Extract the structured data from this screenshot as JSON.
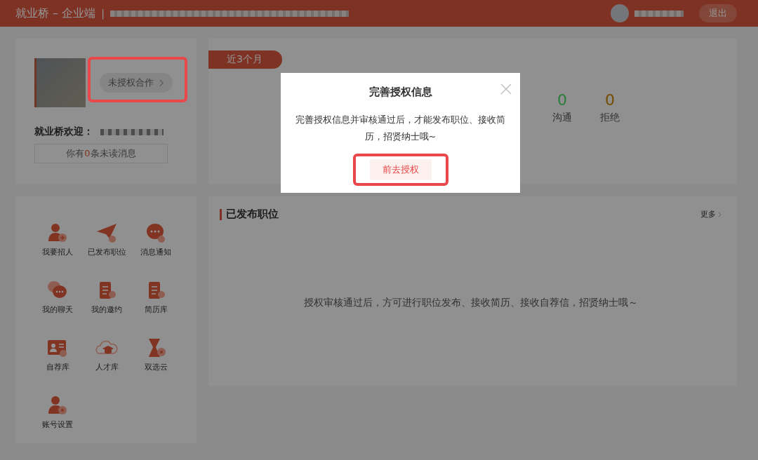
{
  "header": {
    "title": "就业桥 – 企业端",
    "separator": "|",
    "logout": "退出"
  },
  "profile": {
    "status_button": "未授权合作",
    "welcome": "就业桥欢迎：",
    "unread_prefix": "你有",
    "unread_count": "0",
    "unread_suffix": "条未读消息"
  },
  "stats": {
    "period_tab": "近3个月",
    "items": [
      {
        "value": "0",
        "label": "沟通",
        "color": "#2e7d3c"
      },
      {
        "value": "0",
        "label": "拒绝",
        "color": "#744c00"
      }
    ]
  },
  "menu": [
    {
      "kind": "recruit",
      "label": "我要招人"
    },
    {
      "kind": "posted",
      "label": "已发布职位"
    },
    {
      "kind": "notice",
      "label": "消息通知"
    },
    {
      "kind": "chat",
      "label": "我的聊天"
    },
    {
      "kind": "invite",
      "label": "我的邀约"
    },
    {
      "kind": "resume",
      "label": "简历库"
    },
    {
      "kind": "selfrec",
      "label": "自荐库"
    },
    {
      "kind": "talent",
      "label": "人才库"
    },
    {
      "kind": "fair",
      "label": "双选云"
    },
    {
      "kind": "account",
      "label": "账号设置"
    }
  ],
  "jobs_panel": {
    "title": "已发布职位",
    "more": "更多",
    "empty_text": "授权审核通过后，方可进行职位发布、接收简历、接收自荐信，招贤纳士哦～"
  },
  "modal": {
    "title": "完善授权信息",
    "body": "完善授权信息并审核通过后，才能发布职位、接收简历，招贤纳士哦~",
    "button": "前去授权"
  }
}
